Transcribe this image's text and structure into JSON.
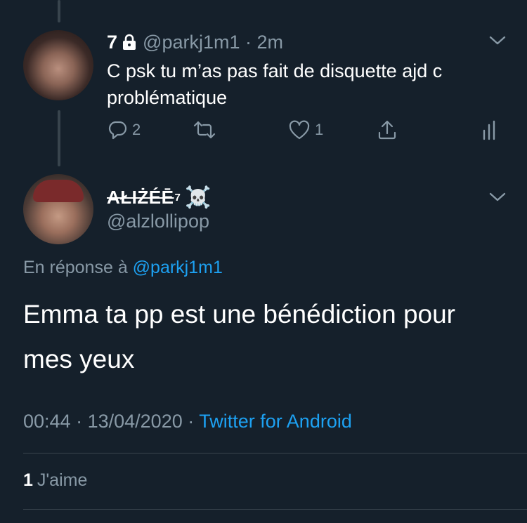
{
  "tweet1": {
    "name": "7",
    "handle": "@parkj1m1",
    "time": "2m",
    "text": "C psk tu m’as pas fait de disquette ajd c problématique",
    "actions": {
      "reply_count": "2",
      "like_count": "1"
    }
  },
  "tweet2": {
    "name": "AŁIŻÉĒ",
    "name_sup": "7",
    "name_emoji": "☠️",
    "handle": "@alzlollipop",
    "reply_prefix": "En réponse à",
    "reply_mention": "@parkj1m1",
    "text": "Emma ta pp est une bénédiction pour mes yeux",
    "time": "00:44",
    "date": "13/04/2020",
    "source": "Twitter for Android",
    "likes_count": "1",
    "likes_label": "J'aime"
  },
  "colors": {
    "background": "#15202b",
    "muted": "#8899a6",
    "accent": "#1da1f2",
    "divider": "#38444d"
  }
}
